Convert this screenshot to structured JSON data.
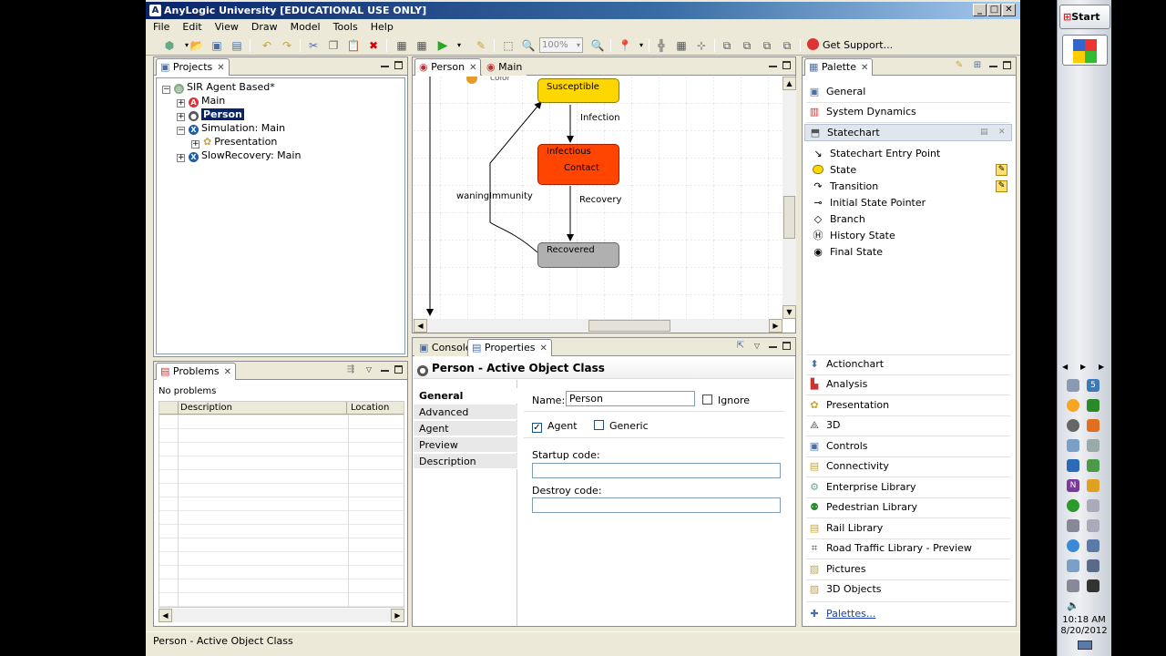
{
  "window": {
    "title": "AnyLogic University [EDUCATIONAL USE ONLY]",
    "controls": [
      "_",
      "□",
      "✕"
    ]
  },
  "menu": [
    "File",
    "Edit",
    "View",
    "Draw",
    "Model",
    "Tools",
    "Help"
  ],
  "toolbar": {
    "zoom": "100%",
    "support": "Get Support..."
  },
  "projects": {
    "tab": "Projects",
    "root": "SIR Agent Based*",
    "items": [
      "Main",
      "Person",
      "Simulation: Main",
      "Presentation",
      "SlowRecovery: Main"
    ]
  },
  "problems": {
    "tab": "Problems",
    "summary": "No problems",
    "columns": [
      "Description",
      "Location"
    ]
  },
  "editor": {
    "tabs": [
      "Person",
      "Main"
    ],
    "states": {
      "susceptible": "Susceptible",
      "infectious": "Infectious",
      "contact": "Contact",
      "recovered": "Recovered"
    },
    "transitions": {
      "infection": "Infection",
      "recovery": "Recovery",
      "waning": "waningImmunity"
    },
    "partial_label": "color",
    "colors": {
      "susceptible": "#ffd700",
      "infectious": "#ff4500",
      "recovered": "#b0b0b0"
    }
  },
  "bottom": {
    "tabs": [
      "Console",
      "Properties"
    ],
    "header": "Person - Active Object Class",
    "side_tabs": [
      "General",
      "Advanced",
      "Agent",
      "Preview",
      "Description"
    ],
    "name_label": "Name:",
    "name_value": "Person",
    "ignore_label": "Ignore",
    "agent_label": "Agent",
    "generic_label": "Generic",
    "startup_label": "Startup code:",
    "destroy_label": "Destroy code:"
  },
  "palette": {
    "tab": "Palette",
    "sections_top": [
      "General",
      "System Dynamics",
      "Statechart"
    ],
    "statechart_items": [
      "Statechart Entry Point",
      "State",
      "Transition",
      "Initial State Pointer",
      "Branch",
      "History State",
      "Final State"
    ],
    "sections_bottom": [
      "Actionchart",
      "Analysis",
      "Presentation",
      "3D",
      "Controls",
      "Connectivity",
      "Enterprise Library",
      "Pedestrian Library",
      "Rail Library",
      "Road Traffic Library - Preview",
      "Pictures",
      "3D Objects"
    ],
    "more": "Palettes..."
  },
  "status": "Person - Active Object Class",
  "taskbar": {
    "start": "Start",
    "time": "10:18 AM",
    "date": "8/20/2012"
  }
}
